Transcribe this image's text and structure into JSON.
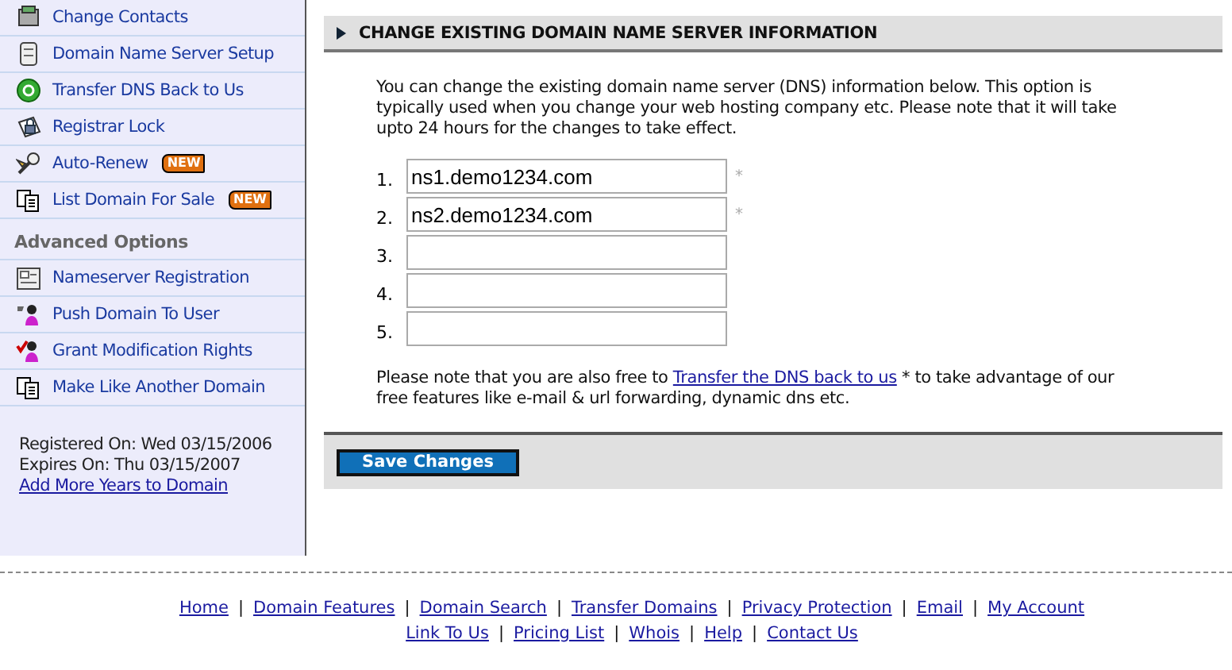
{
  "sidebar": {
    "items": [
      {
        "label": "Change Contacts"
      },
      {
        "label": "Domain Name Server Setup"
      },
      {
        "label": "Transfer DNS Back to Us"
      },
      {
        "label": "Registrar Lock"
      },
      {
        "label": "Auto-Renew",
        "badge": "NEW"
      },
      {
        "label": "List Domain For Sale",
        "badge": "NEW"
      }
    ],
    "advanced_heading": "Advanced Options",
    "advanced_items": [
      {
        "label": "Nameserver Registration"
      },
      {
        "label": "Push Domain To User"
      },
      {
        "label": "Grant Modification Rights"
      },
      {
        "label": "Make Like Another Domain"
      }
    ],
    "registered": "Registered On: Wed 03/15/2006",
    "expires": "Expires On: Thu 03/15/2007",
    "add_years_link": "Add More Years to Domain"
  },
  "panel": {
    "title": "CHANGE EXISTING DOMAIN NAME SERVER INFORMATION",
    "intro": "You can change the existing domain name server (DNS) information below. This option is typically used when you change your web hosting company etc. Please note that it will take upto 24 hours for the changes to take effect.",
    "nameservers": [
      {
        "number": "1.",
        "value": "ns1.demo1234.com",
        "required_mark": "*"
      },
      {
        "number": "2.",
        "value": "ns2.demo1234.com",
        "required_mark": "*"
      },
      {
        "number": "3."
      },
      {
        "number": "4."
      },
      {
        "number": "5."
      }
    ],
    "note_before": "Please note that you are also free to",
    "note_link": "Transfer the DNS back to us",
    "note_after": "* to take advantage of our free features like e-mail & url forwarding, dynamic dns etc.",
    "save_button": "Save Changes"
  },
  "footer": {
    "lines": [
      {
        "links": [
          "Home",
          "Domain Features",
          "Domain Search",
          "Transfer Domains",
          "Privacy Protection",
          "Email",
          "My Account"
        ]
      },
      {
        "links": [
          "Link To Us",
          "Pricing List",
          "Whois",
          "Help",
          "Contact Us"
        ]
      }
    ],
    "separator": "|"
  }
}
